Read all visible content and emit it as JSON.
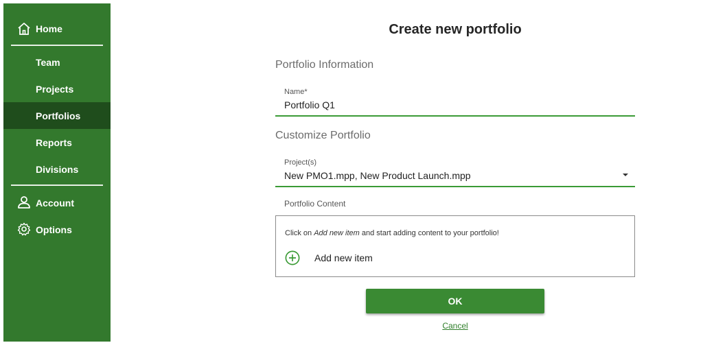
{
  "sidebar": {
    "home": {
      "label": "Home",
      "icon": "home-icon"
    },
    "items": [
      {
        "label": "Team",
        "active": false
      },
      {
        "label": "Projects",
        "active": false
      },
      {
        "label": "Portfolios",
        "active": true
      },
      {
        "label": "Reports",
        "active": false
      },
      {
        "label": "Divisions",
        "active": false
      }
    ],
    "account": {
      "label": "Account",
      "icon": "person-icon"
    },
    "options": {
      "label": "Options",
      "icon": "gear-icon"
    },
    "colors": {
      "background": "#33792d",
      "active": "#1f4d1c"
    }
  },
  "form": {
    "title": "Create new portfolio",
    "info_section": "Portfolio Information",
    "name_label": "Name*",
    "name_value": "Portfolio Q1",
    "customize_section": "Customize Portfolio",
    "projects_label": "Project(s)",
    "projects_value": "New PMO1.mpp, New Product Launch.mpp",
    "content_label": "Portfolio Content",
    "hint_prefix": "Click on ",
    "hint_emphasis": "Add new item",
    "hint_suffix": " and start adding content to your portfolio!",
    "add_item_label": "Add new item",
    "ok_label": "OK",
    "cancel_label": "Cancel",
    "accent_color": "#3a9a35"
  }
}
